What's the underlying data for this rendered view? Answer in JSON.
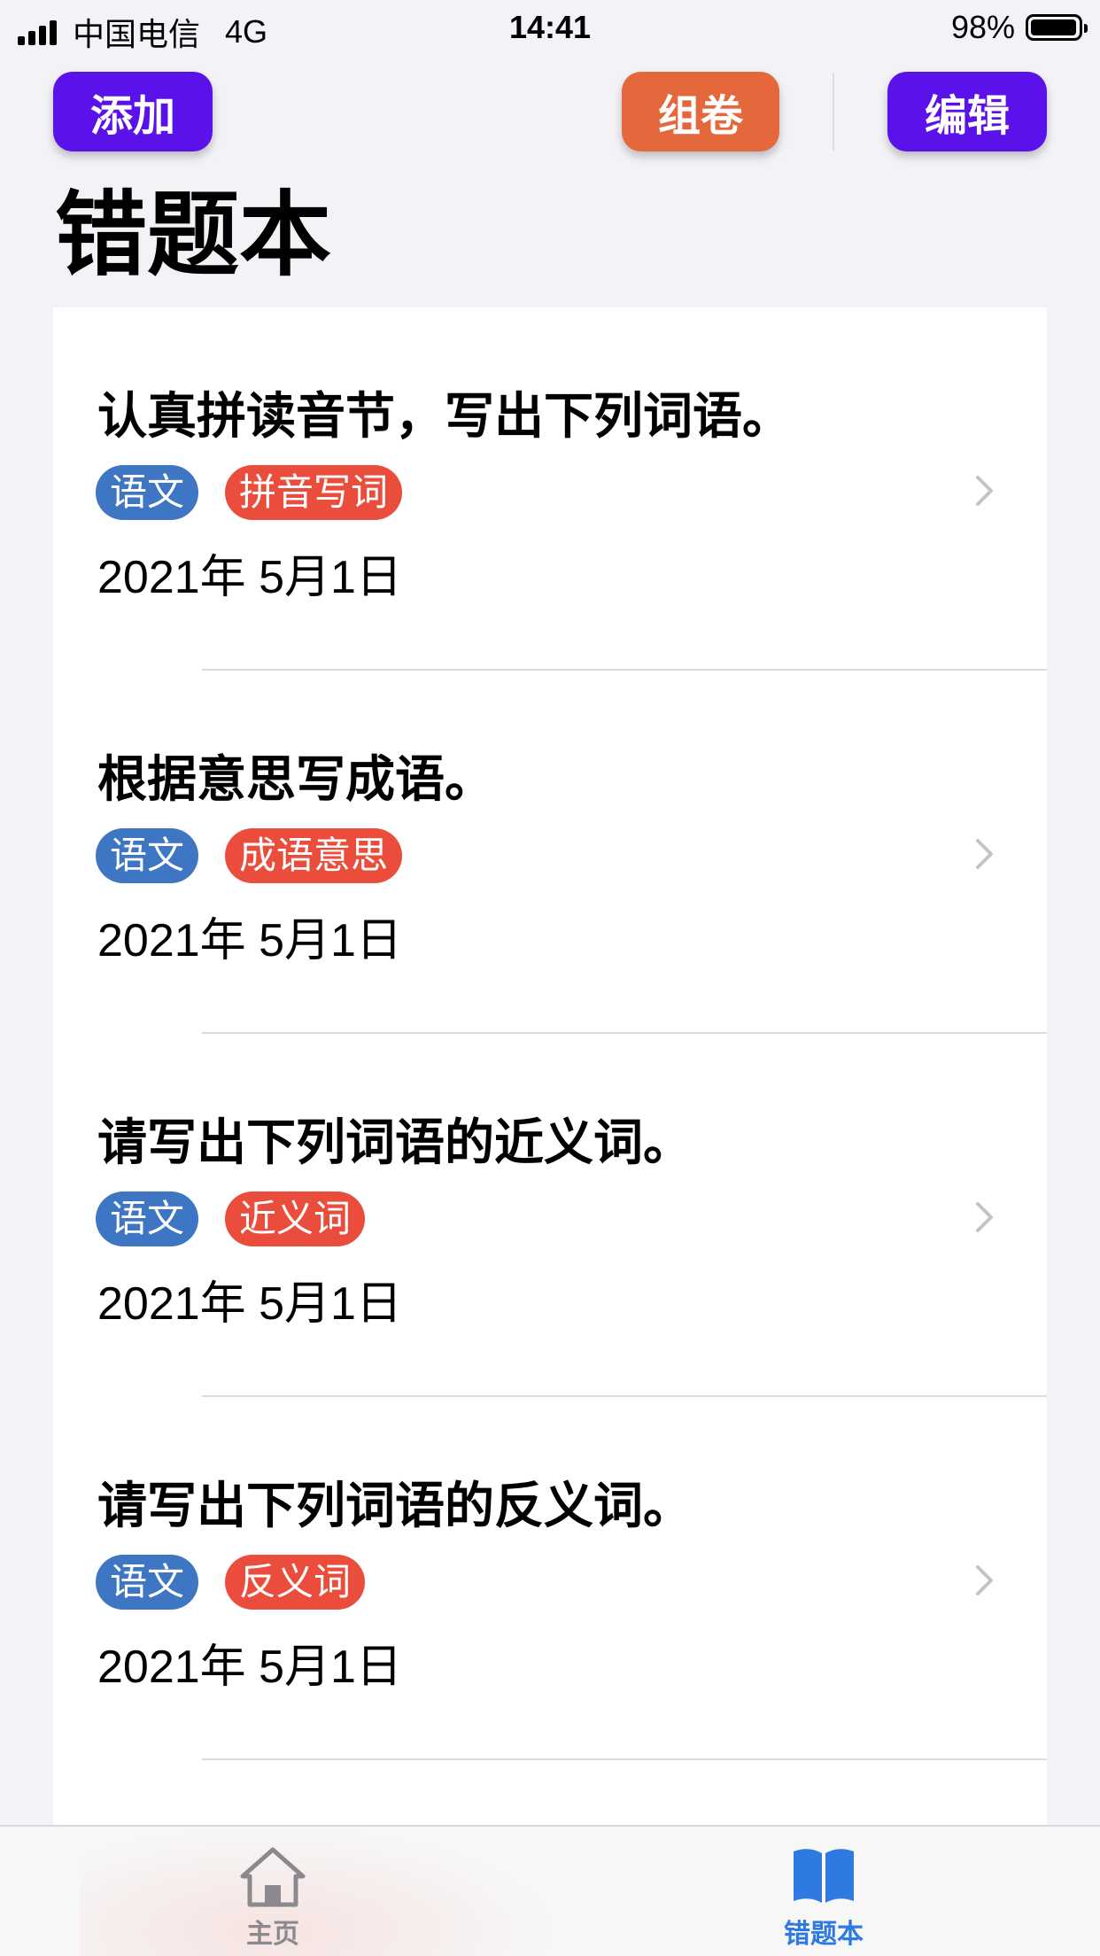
{
  "status_bar": {
    "carrier": "中国电信",
    "network": "4G",
    "time": "14:41",
    "battery_percent": "98%",
    "battery_level": 0.98
  },
  "nav": {
    "add_label": "添加",
    "compose_label": "组卷",
    "edit_label": "编辑"
  },
  "page_title": "错题本",
  "items": [
    {
      "title": "认真拼读音节，写出下列词语。",
      "subject": "语文",
      "topic": "拼音写词",
      "date": "2021年 5月1日"
    },
    {
      "title": "根据意思写成语。",
      "subject": "语文",
      "topic": "成语意思",
      "date": "2021年 5月1日"
    },
    {
      "title": "请写出下列词语的近义词。",
      "subject": "语文",
      "topic": "近义词",
      "date": "2021年 5月1日"
    },
    {
      "title": "请写出下列词语的反义词。",
      "subject": "语文",
      "topic": "反义词",
      "date": "2021年 5月1日"
    }
  ],
  "tab_bar": {
    "home_label": "主页",
    "mistakes_label": "错题本",
    "active": "mistakes"
  },
  "colors": {
    "primary_button": "#5b12ea",
    "compose_button": "#e4683b",
    "subject_tag": "#3f76c4",
    "topic_tag": "#ea4d3b",
    "active_tab": "#2f7ae0",
    "inactive_tab": "#8a8a8e"
  },
  "icons": {
    "home": "house-icon",
    "mistakes": "open-book-icon",
    "row": "chevron-right-icon"
  }
}
